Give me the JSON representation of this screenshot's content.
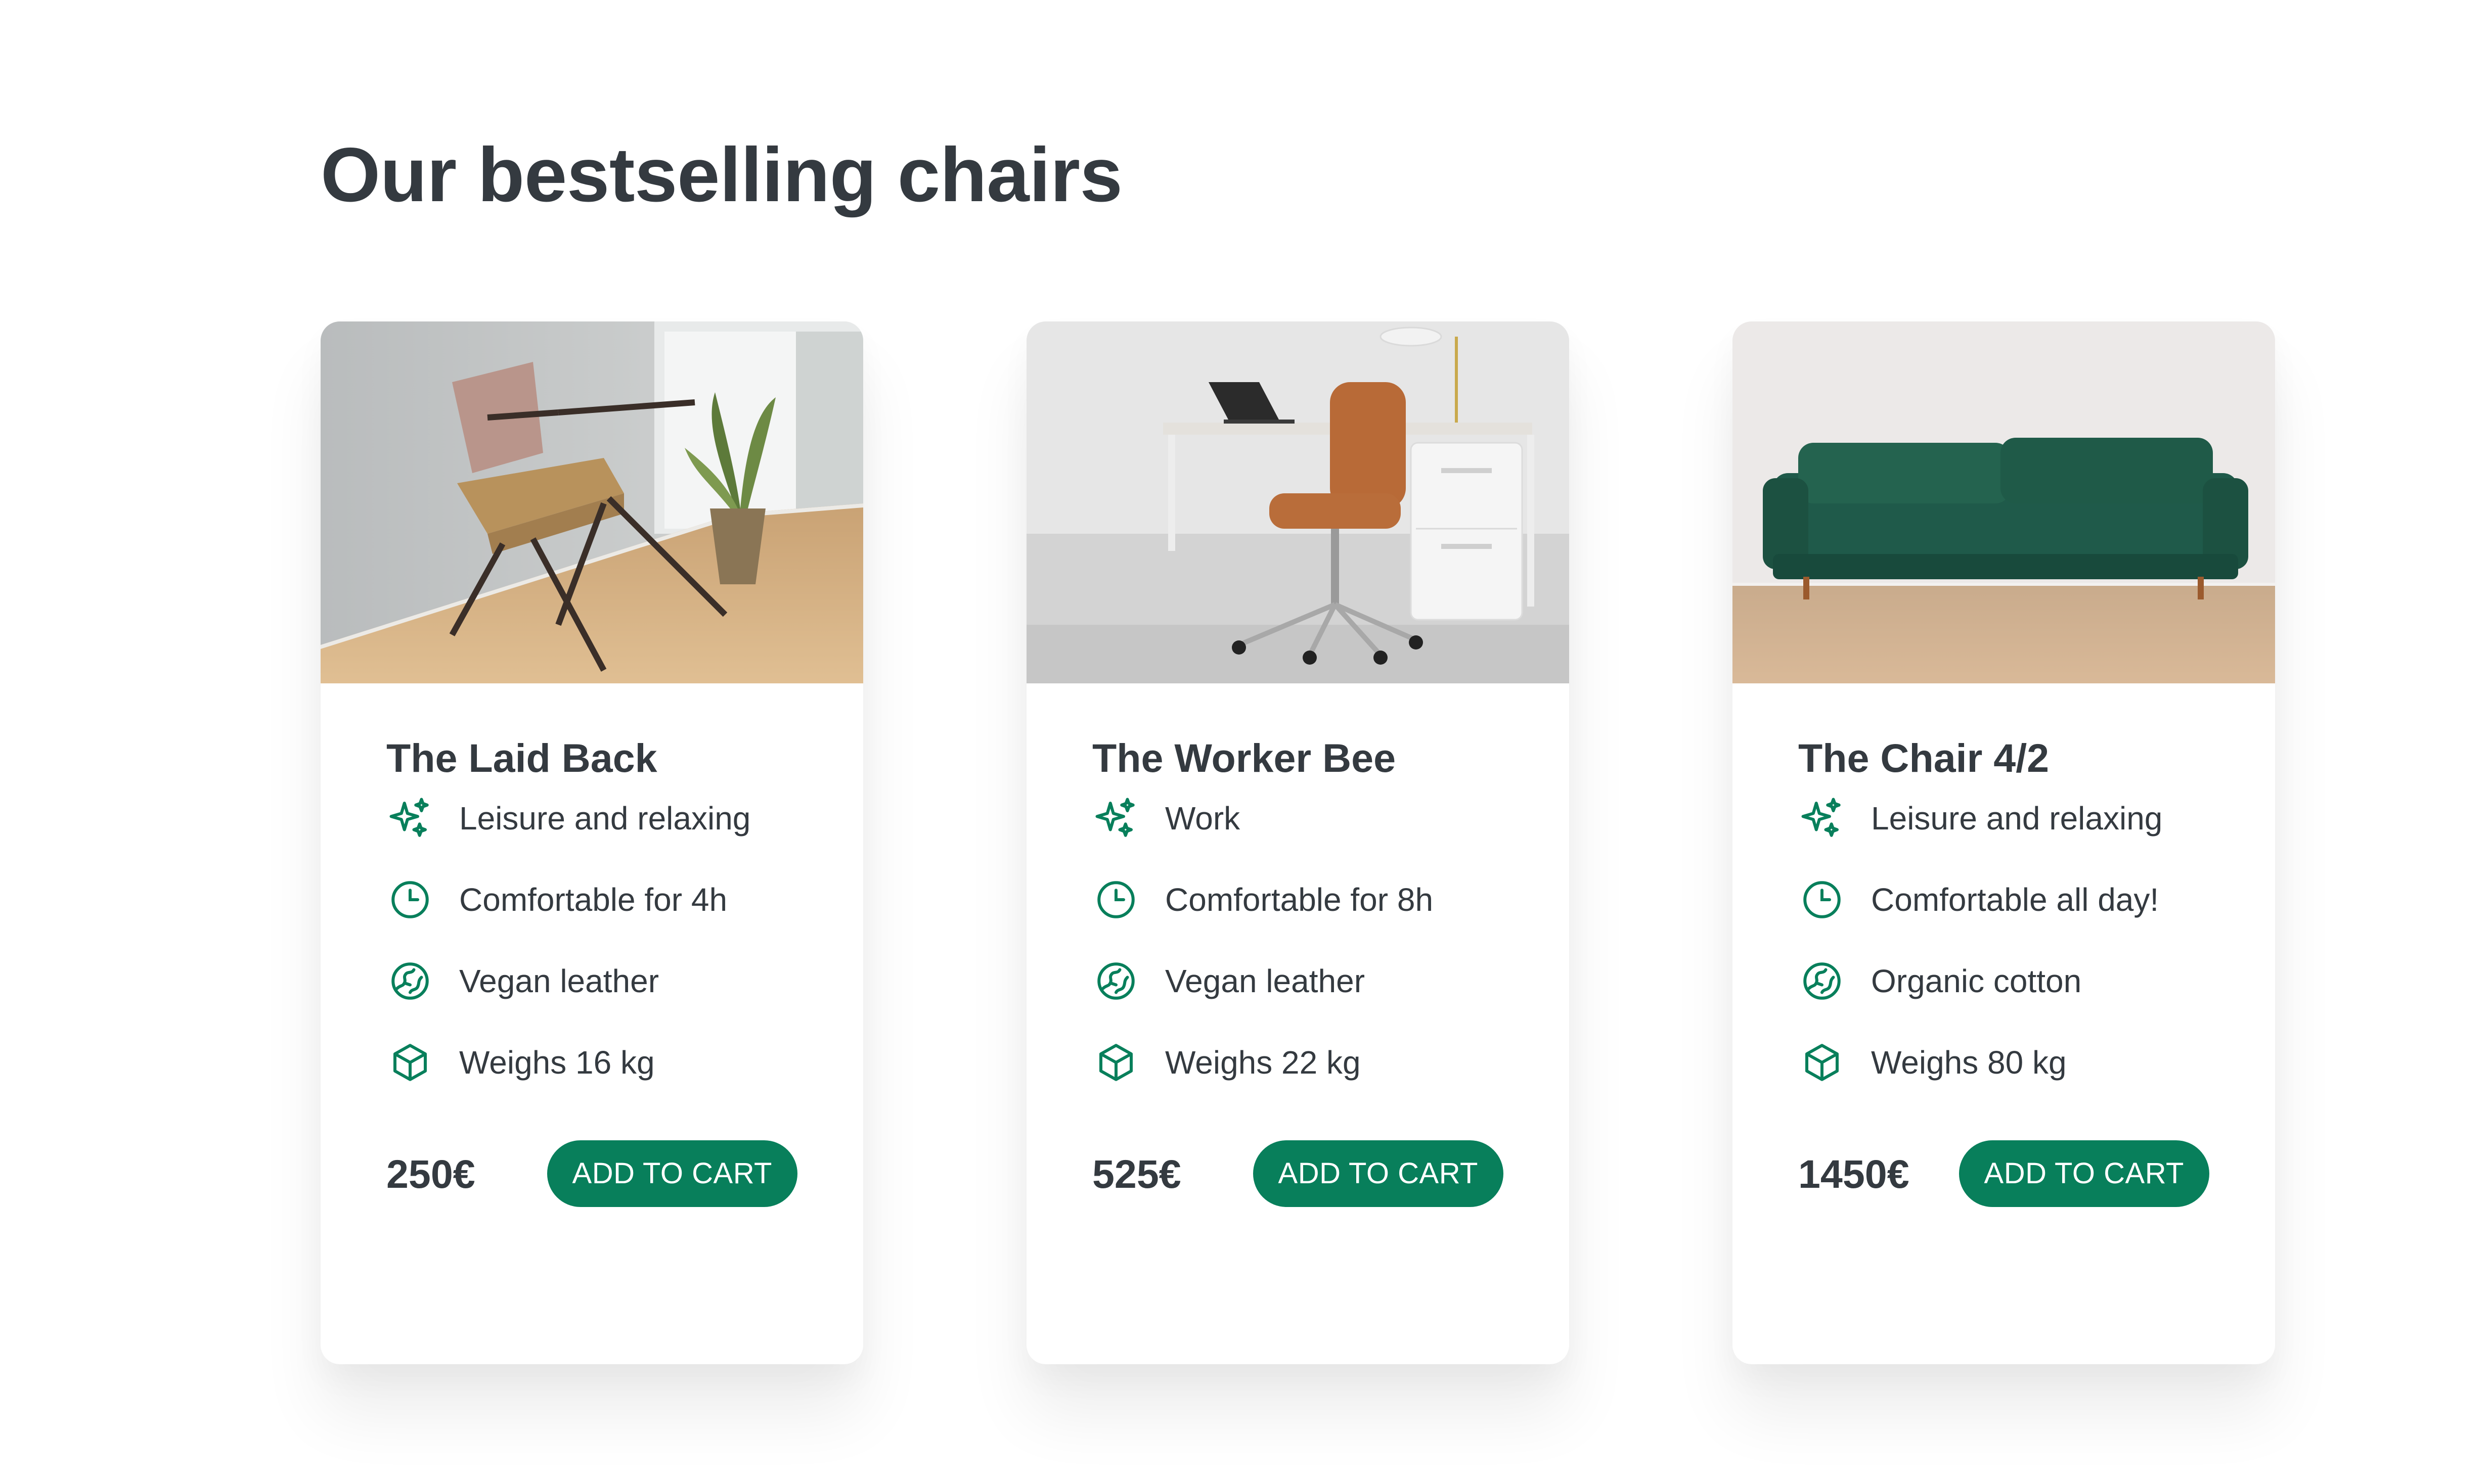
{
  "page": {
    "title": "Our bestselling chairs"
  },
  "colors": {
    "accent": "#087f5b",
    "text": "#343a40",
    "background": "#ffffff"
  },
  "products": [
    {
      "name": "The Laid Back",
      "attributes": [
        {
          "icon": "sparkles-icon",
          "text": "Leisure and relaxing"
        },
        {
          "icon": "clock-icon",
          "text": "Comfortable for 4h"
        },
        {
          "icon": "leaf-globe-icon",
          "text": "Vegan leather"
        },
        {
          "icon": "cube-icon",
          "text": "Weighs 16 kg"
        }
      ],
      "price": "250€",
      "cta": "ADD TO CART",
      "image": "armchair-photo"
    },
    {
      "name": "The Worker Bee",
      "attributes": [
        {
          "icon": "sparkles-icon",
          "text": "Work"
        },
        {
          "icon": "clock-icon",
          "text": "Comfortable for 8h"
        },
        {
          "icon": "leaf-globe-icon",
          "text": "Vegan leather"
        },
        {
          "icon": "cube-icon",
          "text": "Weighs 22 kg"
        }
      ],
      "price": "525€",
      "cta": "ADD TO CART",
      "image": "office-chair-photo"
    },
    {
      "name": "The Chair 4/2",
      "attributes": [
        {
          "icon": "sparkles-icon",
          "text": "Leisure and relaxing"
        },
        {
          "icon": "clock-icon",
          "text": "Comfortable all day!"
        },
        {
          "icon": "leaf-globe-icon",
          "text": "Organic cotton"
        },
        {
          "icon": "cube-icon",
          "text": "Weighs 80 kg"
        }
      ],
      "price": "1450€",
      "cta": "ADD TO CART",
      "image": "green-sofa-photo"
    }
  ]
}
